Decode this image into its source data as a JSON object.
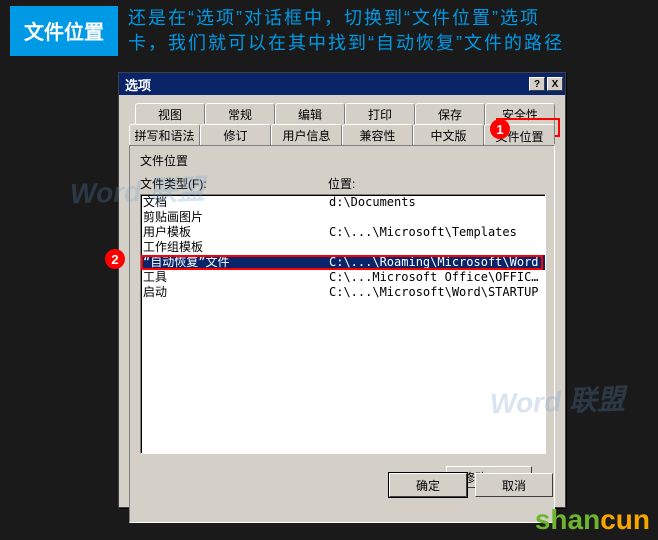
{
  "header": {
    "badge": "文件位置",
    "text_line1": "还是在“选项”对话框中，切换到“文件位置”选项",
    "text_line2": "卡，我们就可以在其中找到“自动恢复”文件的路径"
  },
  "dialog": {
    "title": "选项",
    "help_icon": "?",
    "close_icon": "X",
    "tabs_row1": [
      "视图",
      "常规",
      "编辑",
      "打印",
      "保存",
      "安全性"
    ],
    "tabs_row2": [
      "拼写和语法",
      "修订",
      "用户信息",
      "兼容性",
      "中文版",
      "文件位置"
    ],
    "active_tab_index": 5,
    "group_label": "文件位置",
    "col1": "文件类型(F):",
    "col2": "位置:",
    "rows": [
      {
        "type": "文档",
        "loc": "d:\\Documents"
      },
      {
        "type": "剪贴画图片",
        "loc": ""
      },
      {
        "type": "用户模板",
        "loc": "C:\\...\\Microsoft\\Templates"
      },
      {
        "type": "工作组模板",
        "loc": ""
      },
      {
        "type": "“自动恢复”文件",
        "loc": "C:\\...\\Roaming\\Microsoft\\Word"
      },
      {
        "type": "工具",
        "loc": "C:\\...Microsoft Office\\OFFIC…"
      },
      {
        "type": "启动",
        "loc": "C:\\...\\Microsoft\\Word\\STARTUP"
      }
    ],
    "selected_row_index": 4,
    "modify_label": "修改(M)...",
    "ok_label": "确定",
    "cancel_label": "取消"
  },
  "badges": {
    "b1": "1",
    "b2": "2"
  },
  "watermark": "Word 联盟",
  "shancun": {
    "part1": "shan",
    "part2": "cun"
  }
}
